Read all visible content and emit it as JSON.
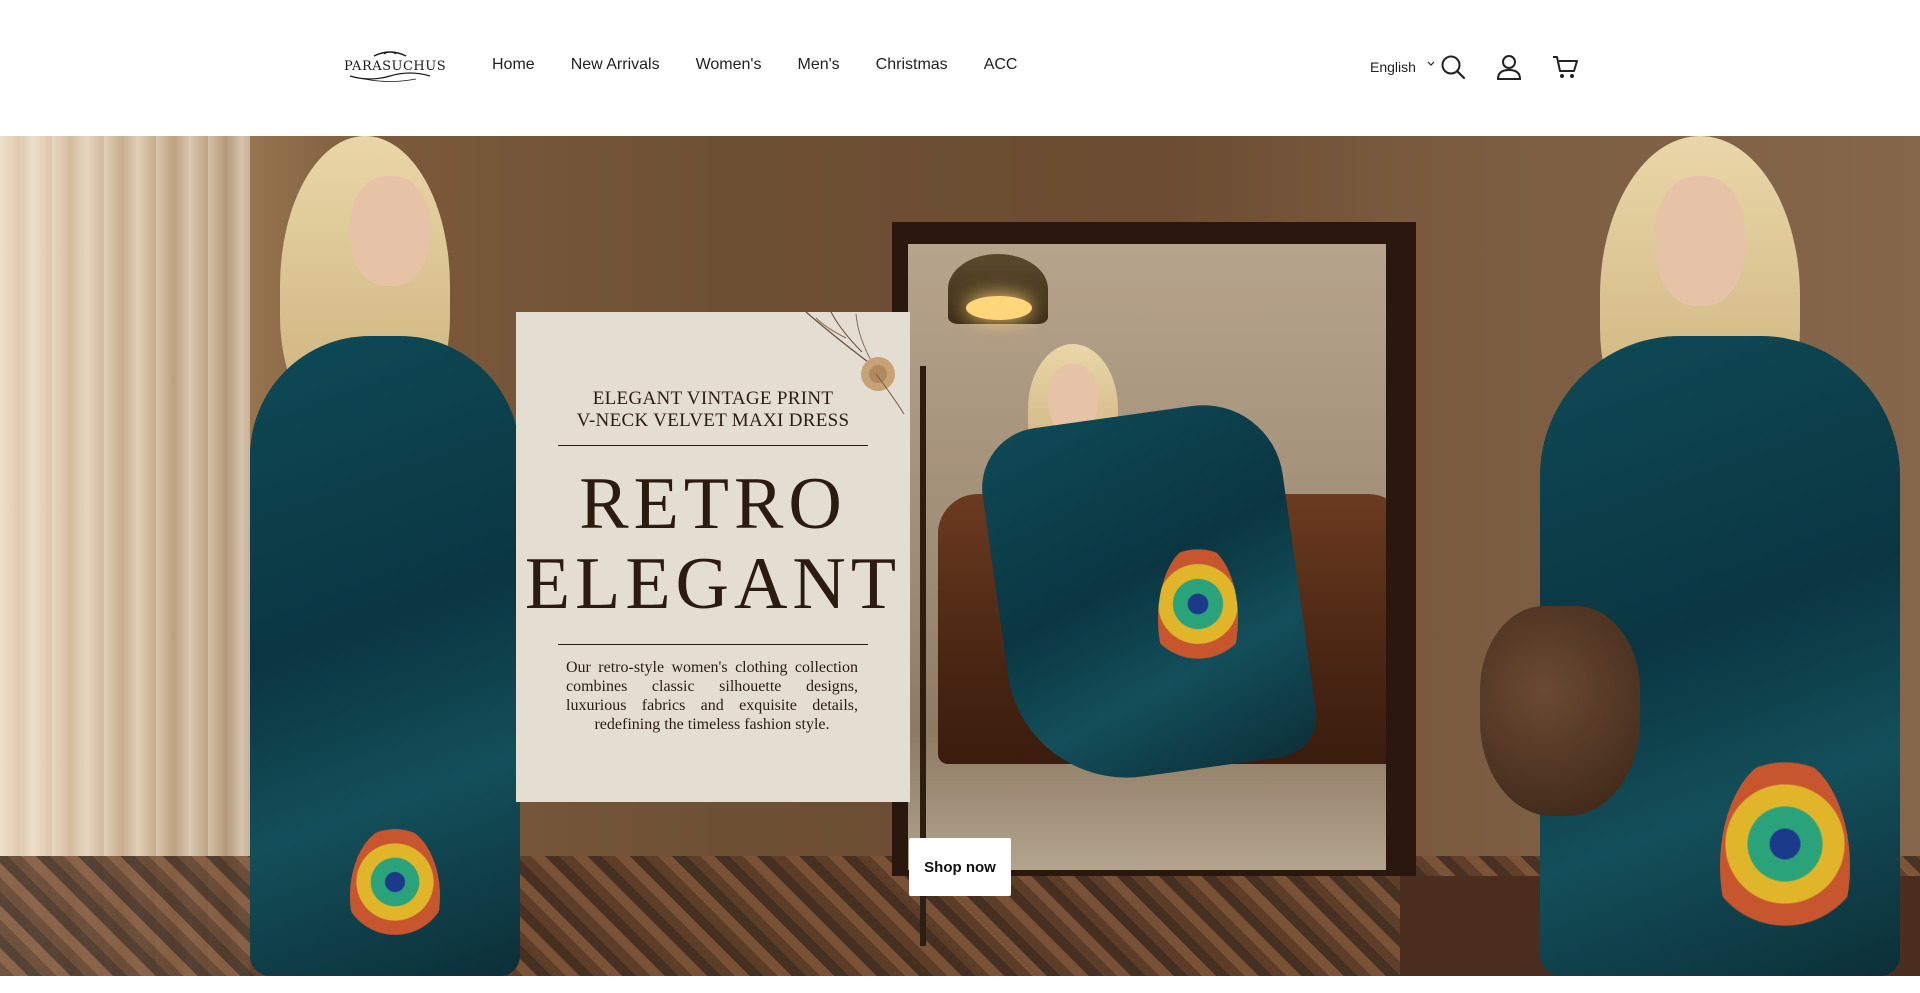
{
  "header": {
    "logo_text": "PARASUCHUS",
    "nav": [
      "Home",
      "New Arrivals",
      "Women's",
      "Men's",
      "Christmas",
      "ACC"
    ],
    "language": "English",
    "icons": [
      "search-icon",
      "account-icon",
      "cart-icon"
    ]
  },
  "hero": {
    "subtitle_line1": "ELEGANT VINTAGE PRINT",
    "subtitle_line2": "V-NECK VELVET MAXI DRESS",
    "title_line1": "RETRO",
    "title_line2": "ELEGANT",
    "description": "Our retro-style women's clothing collection combines classic silhouette designs, luxurious fabrics and exquisite details, redefining the timeless fashion style.",
    "cta": "Shop now"
  },
  "colors": {
    "card_bg": "#e4ddd2",
    "title_text": "#2b1b10",
    "dress_teal": "#0f4a57",
    "frame": "#2a170d"
  }
}
